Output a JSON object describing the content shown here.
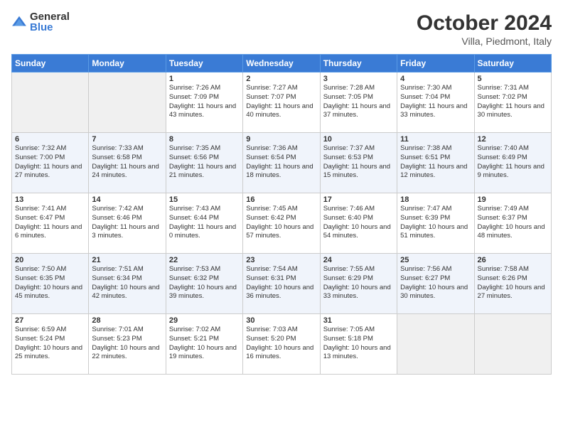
{
  "header": {
    "logo_general": "General",
    "logo_blue": "Blue",
    "title": "October 2024",
    "subtitle": "Villa, Piedmont, Italy"
  },
  "days_of_week": [
    "Sunday",
    "Monday",
    "Tuesday",
    "Wednesday",
    "Thursday",
    "Friday",
    "Saturday"
  ],
  "weeks": [
    [
      {
        "day": "",
        "sunrise": "",
        "sunset": "",
        "daylight": "",
        "empty": true
      },
      {
        "day": "",
        "sunrise": "",
        "sunset": "",
        "daylight": "",
        "empty": true
      },
      {
        "day": "1",
        "sunrise": "Sunrise: 7:26 AM",
        "sunset": "Sunset: 7:09 PM",
        "daylight": "Daylight: 11 hours and 43 minutes."
      },
      {
        "day": "2",
        "sunrise": "Sunrise: 7:27 AM",
        "sunset": "Sunset: 7:07 PM",
        "daylight": "Daylight: 11 hours and 40 minutes."
      },
      {
        "day": "3",
        "sunrise": "Sunrise: 7:28 AM",
        "sunset": "Sunset: 7:05 PM",
        "daylight": "Daylight: 11 hours and 37 minutes."
      },
      {
        "day": "4",
        "sunrise": "Sunrise: 7:30 AM",
        "sunset": "Sunset: 7:04 PM",
        "daylight": "Daylight: 11 hours and 33 minutes."
      },
      {
        "day": "5",
        "sunrise": "Sunrise: 7:31 AM",
        "sunset": "Sunset: 7:02 PM",
        "daylight": "Daylight: 11 hours and 30 minutes."
      }
    ],
    [
      {
        "day": "6",
        "sunrise": "Sunrise: 7:32 AM",
        "sunset": "Sunset: 7:00 PM",
        "daylight": "Daylight: 11 hours and 27 minutes."
      },
      {
        "day": "7",
        "sunrise": "Sunrise: 7:33 AM",
        "sunset": "Sunset: 6:58 PM",
        "daylight": "Daylight: 11 hours and 24 minutes."
      },
      {
        "day": "8",
        "sunrise": "Sunrise: 7:35 AM",
        "sunset": "Sunset: 6:56 PM",
        "daylight": "Daylight: 11 hours and 21 minutes."
      },
      {
        "day": "9",
        "sunrise": "Sunrise: 7:36 AM",
        "sunset": "Sunset: 6:54 PM",
        "daylight": "Daylight: 11 hours and 18 minutes."
      },
      {
        "day": "10",
        "sunrise": "Sunrise: 7:37 AM",
        "sunset": "Sunset: 6:53 PM",
        "daylight": "Daylight: 11 hours and 15 minutes."
      },
      {
        "day": "11",
        "sunrise": "Sunrise: 7:38 AM",
        "sunset": "Sunset: 6:51 PM",
        "daylight": "Daylight: 11 hours and 12 minutes."
      },
      {
        "day": "12",
        "sunrise": "Sunrise: 7:40 AM",
        "sunset": "Sunset: 6:49 PM",
        "daylight": "Daylight: 11 hours and 9 minutes."
      }
    ],
    [
      {
        "day": "13",
        "sunrise": "Sunrise: 7:41 AM",
        "sunset": "Sunset: 6:47 PM",
        "daylight": "Daylight: 11 hours and 6 minutes."
      },
      {
        "day": "14",
        "sunrise": "Sunrise: 7:42 AM",
        "sunset": "Sunset: 6:46 PM",
        "daylight": "Daylight: 11 hours and 3 minutes."
      },
      {
        "day": "15",
        "sunrise": "Sunrise: 7:43 AM",
        "sunset": "Sunset: 6:44 PM",
        "daylight": "Daylight: 11 hours and 0 minutes."
      },
      {
        "day": "16",
        "sunrise": "Sunrise: 7:45 AM",
        "sunset": "Sunset: 6:42 PM",
        "daylight": "Daylight: 10 hours and 57 minutes."
      },
      {
        "day": "17",
        "sunrise": "Sunrise: 7:46 AM",
        "sunset": "Sunset: 6:40 PM",
        "daylight": "Daylight: 10 hours and 54 minutes."
      },
      {
        "day": "18",
        "sunrise": "Sunrise: 7:47 AM",
        "sunset": "Sunset: 6:39 PM",
        "daylight": "Daylight: 10 hours and 51 minutes."
      },
      {
        "day": "19",
        "sunrise": "Sunrise: 7:49 AM",
        "sunset": "Sunset: 6:37 PM",
        "daylight": "Daylight: 10 hours and 48 minutes."
      }
    ],
    [
      {
        "day": "20",
        "sunrise": "Sunrise: 7:50 AM",
        "sunset": "Sunset: 6:35 PM",
        "daylight": "Daylight: 10 hours and 45 minutes."
      },
      {
        "day": "21",
        "sunrise": "Sunrise: 7:51 AM",
        "sunset": "Sunset: 6:34 PM",
        "daylight": "Daylight: 10 hours and 42 minutes."
      },
      {
        "day": "22",
        "sunrise": "Sunrise: 7:53 AM",
        "sunset": "Sunset: 6:32 PM",
        "daylight": "Daylight: 10 hours and 39 minutes."
      },
      {
        "day": "23",
        "sunrise": "Sunrise: 7:54 AM",
        "sunset": "Sunset: 6:31 PM",
        "daylight": "Daylight: 10 hours and 36 minutes."
      },
      {
        "day": "24",
        "sunrise": "Sunrise: 7:55 AM",
        "sunset": "Sunset: 6:29 PM",
        "daylight": "Daylight: 10 hours and 33 minutes."
      },
      {
        "day": "25",
        "sunrise": "Sunrise: 7:56 AM",
        "sunset": "Sunset: 6:27 PM",
        "daylight": "Daylight: 10 hours and 30 minutes."
      },
      {
        "day": "26",
        "sunrise": "Sunrise: 7:58 AM",
        "sunset": "Sunset: 6:26 PM",
        "daylight": "Daylight: 10 hours and 27 minutes."
      }
    ],
    [
      {
        "day": "27",
        "sunrise": "Sunrise: 6:59 AM",
        "sunset": "Sunset: 5:24 PM",
        "daylight": "Daylight: 10 hours and 25 minutes."
      },
      {
        "day": "28",
        "sunrise": "Sunrise: 7:01 AM",
        "sunset": "Sunset: 5:23 PM",
        "daylight": "Daylight: 10 hours and 22 minutes."
      },
      {
        "day": "29",
        "sunrise": "Sunrise: 7:02 AM",
        "sunset": "Sunset: 5:21 PM",
        "daylight": "Daylight: 10 hours and 19 minutes."
      },
      {
        "day": "30",
        "sunrise": "Sunrise: 7:03 AM",
        "sunset": "Sunset: 5:20 PM",
        "daylight": "Daylight: 10 hours and 16 minutes."
      },
      {
        "day": "31",
        "sunrise": "Sunrise: 7:05 AM",
        "sunset": "Sunset: 5:18 PM",
        "daylight": "Daylight: 10 hours and 13 minutes."
      },
      {
        "day": "",
        "sunrise": "",
        "sunset": "",
        "daylight": "",
        "empty": true
      },
      {
        "day": "",
        "sunrise": "",
        "sunset": "",
        "daylight": "",
        "empty": true
      }
    ]
  ]
}
